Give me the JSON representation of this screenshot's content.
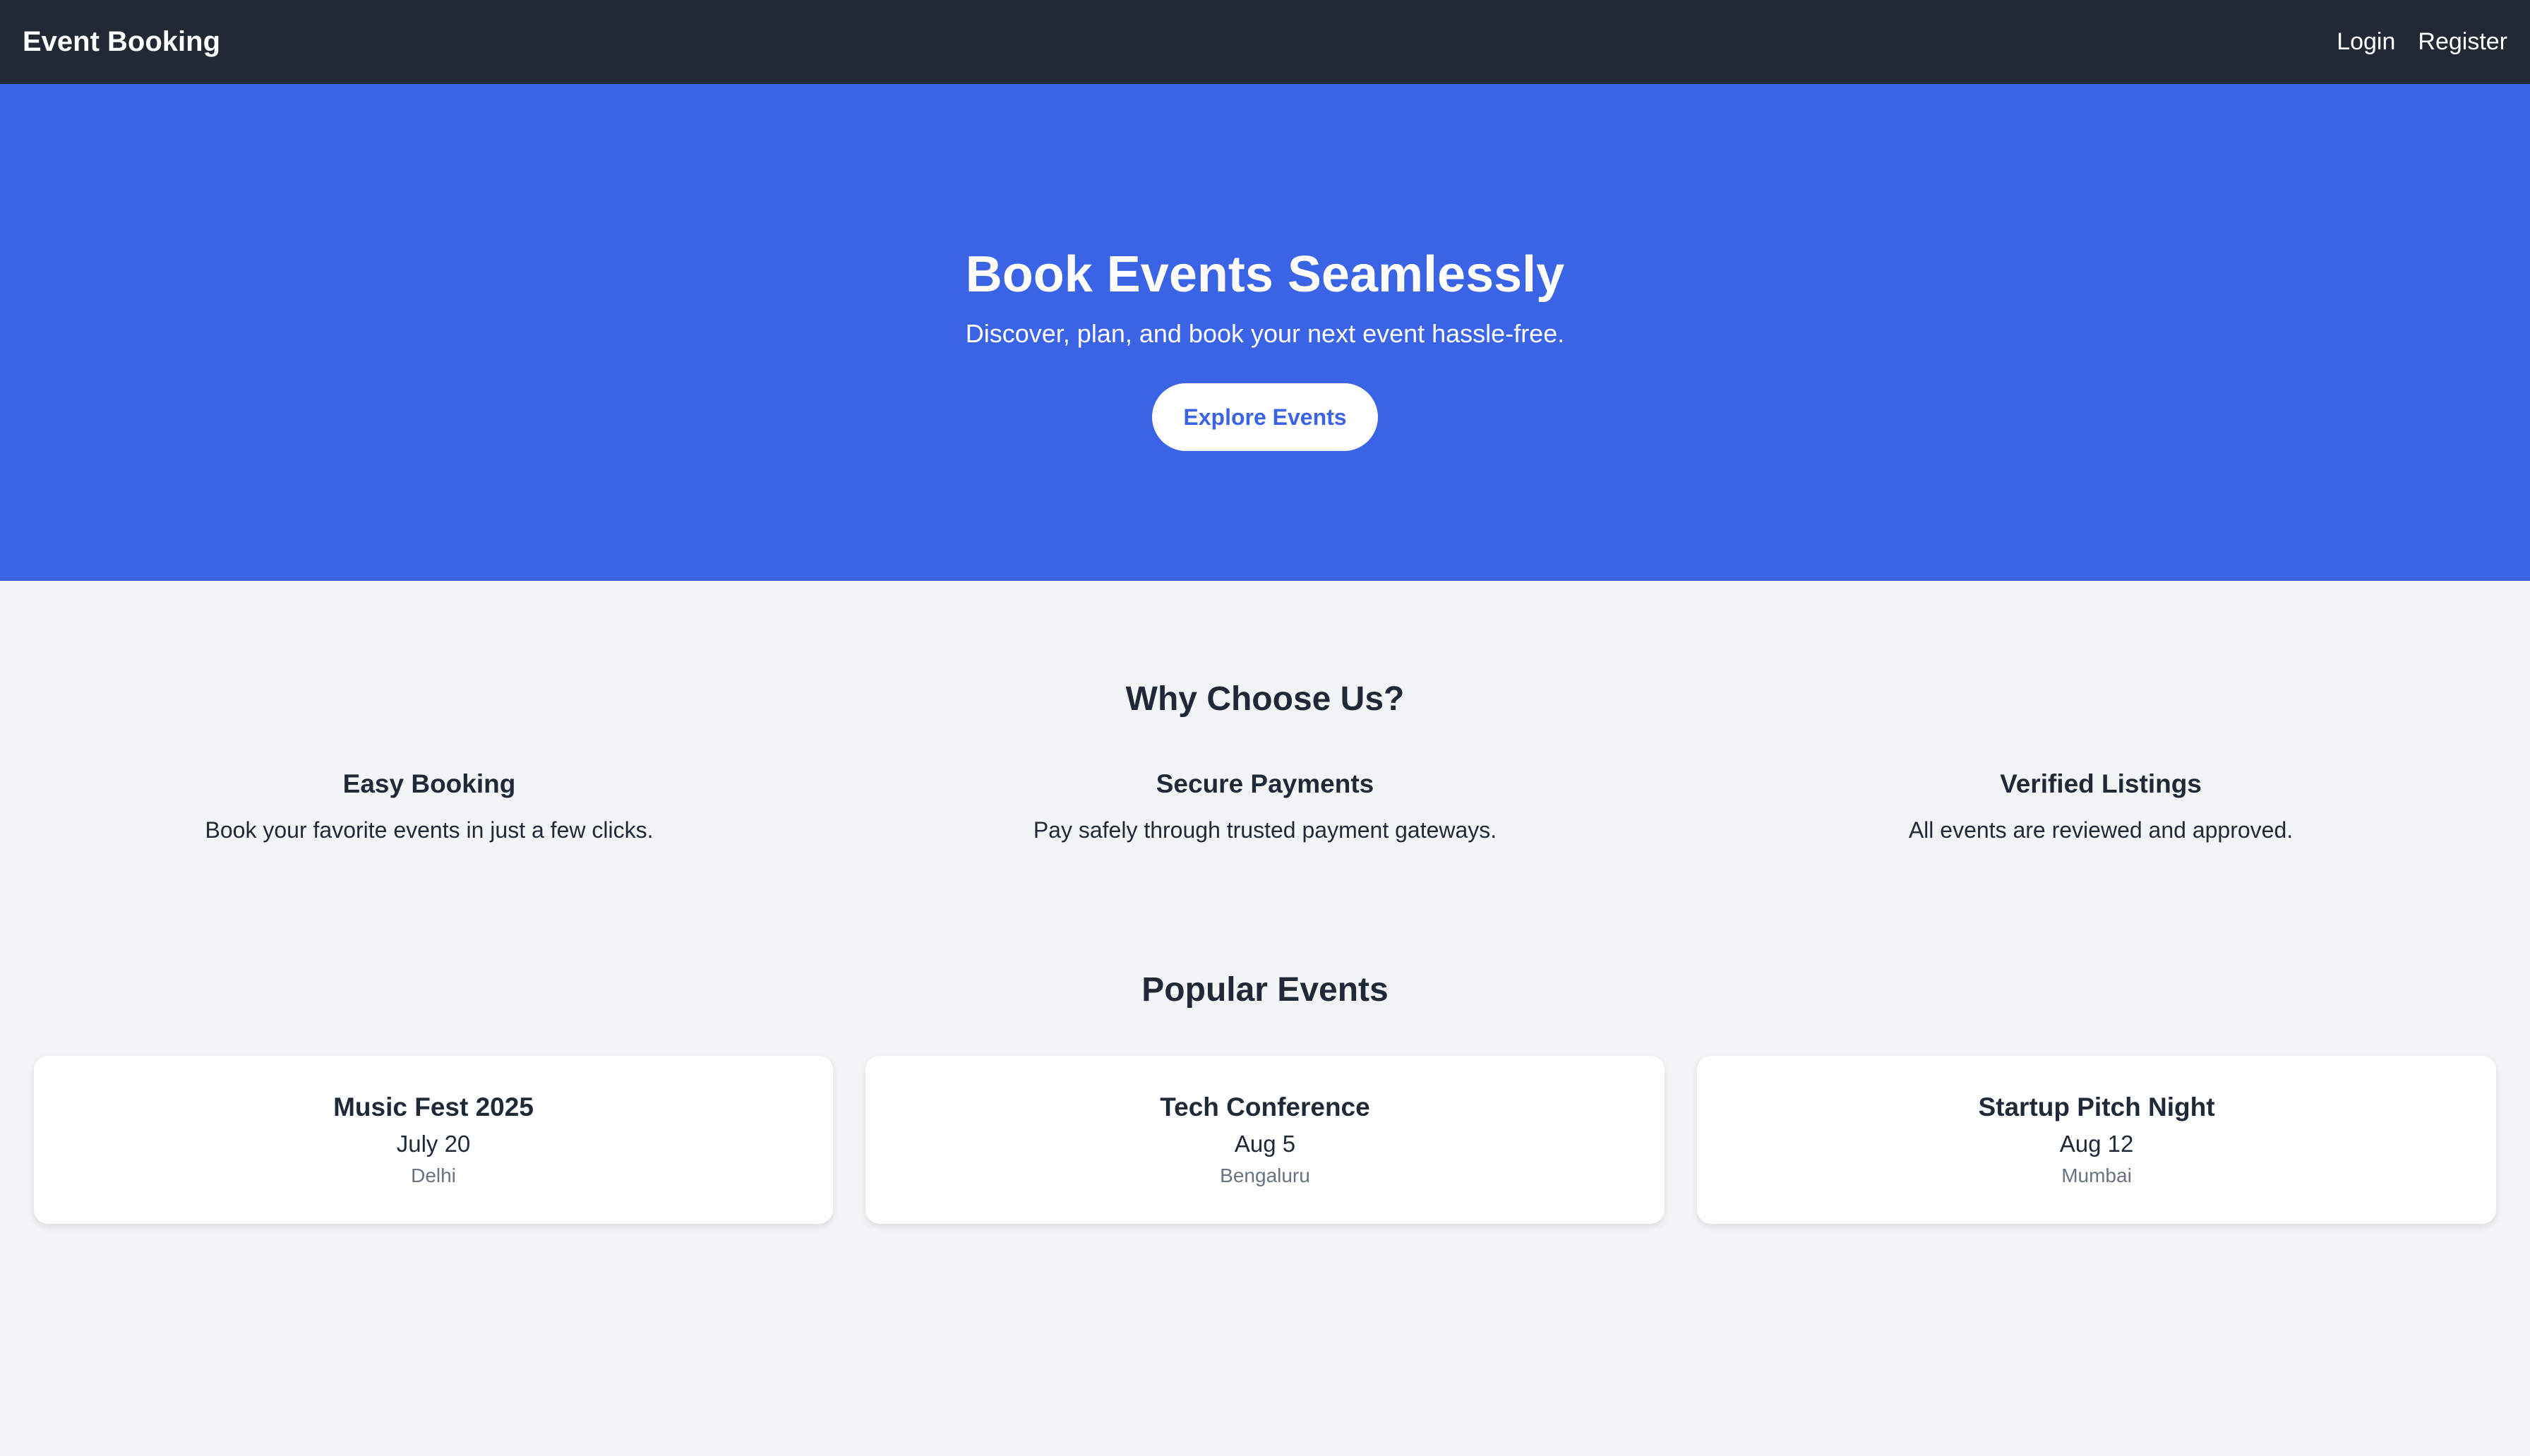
{
  "navbar": {
    "brand": "Event Booking",
    "links": [
      "Login",
      "Register"
    ]
  },
  "hero": {
    "title": "Book Events Seamlessly",
    "subtitle": "Discover, plan, and book your next event hassle-free.",
    "cta": "Explore Events"
  },
  "why": {
    "title": "Why Choose Us?",
    "features": [
      {
        "title": "Easy Booking",
        "text": "Book your favorite events in just a few clicks."
      },
      {
        "title": "Secure Payments",
        "text": "Pay safely through trusted payment gateways."
      },
      {
        "title": "Verified Listings",
        "text": "All events are reviewed and approved."
      }
    ]
  },
  "events": {
    "title": "Popular Events",
    "items": [
      {
        "name": "Music Fest 2025",
        "date": "July 20",
        "city": "Delhi"
      },
      {
        "name": "Tech Conference",
        "date": "Aug 5",
        "city": "Bengaluru"
      },
      {
        "name": "Startup Pitch Night",
        "date": "Aug 12",
        "city": "Mumbai"
      }
    ]
  },
  "colors": {
    "navbar": "#222834",
    "hero": "#3a63e5",
    "page_bg": "#f3f4f6",
    "text": "#1f2937",
    "muted": "#6b7280"
  }
}
